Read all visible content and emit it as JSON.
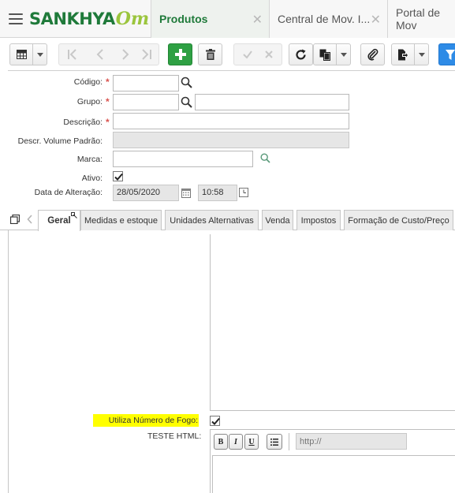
{
  "app": {
    "brand": "SANKHYA",
    "brand_suffix": "Om"
  },
  "tabs": [
    {
      "label": "Produtos",
      "active": true
    },
    {
      "label": "Central de Mov. I...",
      "active": false
    },
    {
      "label": "Portal de Mov",
      "active": false
    }
  ],
  "toolbar": {
    "buttons": [
      "grid-view",
      "first",
      "previous",
      "next",
      "last",
      "add",
      "delete",
      "confirm",
      "cancel",
      "refresh",
      "duplicate",
      "attach",
      "export",
      "filter"
    ]
  },
  "form": {
    "codigo": {
      "label": "Código:",
      "value": "",
      "required": true
    },
    "grupo": {
      "label": "Grupo:",
      "value": "",
      "description": "",
      "required": true
    },
    "descricao": {
      "label": "Descrição:",
      "value": "",
      "required": true
    },
    "descr_volume": {
      "label": "Descr. Volume Padrão:",
      "value": ""
    },
    "marca": {
      "label": "Marca:",
      "value": ""
    },
    "ativo": {
      "label": "Ativo:",
      "checked": true
    },
    "data_alteracao": {
      "label": "Data de Alteração:",
      "date": "28/05/2020",
      "time": "10:58"
    }
  },
  "form_tabs": [
    {
      "label": "Geral",
      "active": true
    },
    {
      "label": "Medidas e estoque",
      "active": false
    },
    {
      "label": "Unidades Alternativas",
      "active": false
    },
    {
      "label": "Venda",
      "active": false
    },
    {
      "label": "Impostos",
      "active": false
    },
    {
      "label": "Formação de Custo/Preço",
      "active": false
    }
  ],
  "content": {
    "fogo_label": "Utiliza Número de Fogo:",
    "fogo_checked": true,
    "teste_html_label": "TESTE HTML:",
    "editor": {
      "bold": "B",
      "italic": "I",
      "underline": "U",
      "link_placeholder": "http://"
    }
  },
  "colors": {
    "brand_green": "#1f7a3a",
    "brand_lime": "#9bc53d",
    "highlight": "#ffff00",
    "add_button": "#2ea043",
    "filter_button": "#2e8be6",
    "required": "#d9534f"
  }
}
